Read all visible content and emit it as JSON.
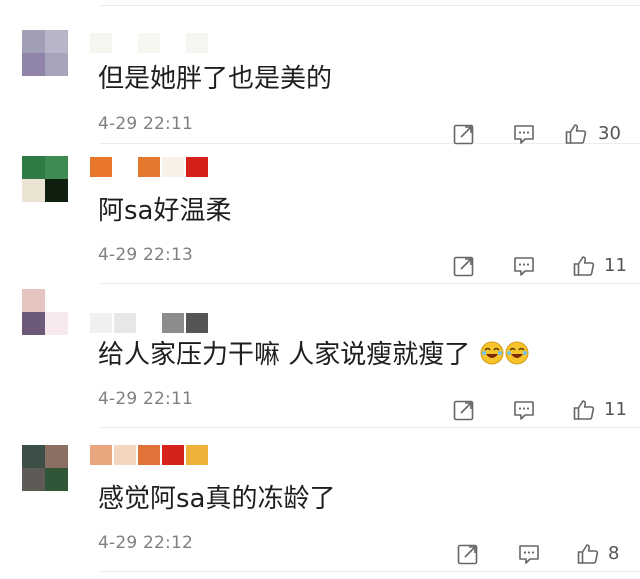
{
  "comments": [
    {
      "avatar_colors": [
        "#a19fb6",
        "#b9b4c8",
        "#9085a8",
        "#a6a3ba"
      ],
      "username_colors": [
        "#f7f5ef",
        "#f8f6f1",
        "#f7f5f2"
      ],
      "text": "但是她胖了也是美的",
      "time": "4-29 22:11",
      "likes": "30"
    },
    {
      "avatar_colors": [
        "#2f7a45",
        "#3f8b53",
        "#ece4d3",
        "#10200f"
      ],
      "username_colors": [
        "#e8772b",
        "#ffffff",
        "#e3782c",
        "#f8f1e7",
        "#d5201a"
      ],
      "text": "阿sa好温柔",
      "time": "4-29 22:13",
      "likes": "11"
    },
    {
      "avatar_colors": [
        "#e6c4c0",
        "#ffffff",
        "#6c5a78",
        "#f7e9ef"
      ],
      "username_colors": [
        "#f1eff0",
        "#e7e6e8",
        "#ffffff",
        "#8c8c8c",
        "#555555"
      ],
      "text": "给人家压力干嘛 人家说瘦就瘦了",
      "emoji_name": "laugh-cry-emoji",
      "time": "4-29 22:11",
      "likes": "11"
    },
    {
      "avatar_colors": [
        "#3b4f47",
        "#8b6f63",
        "#5e5a56",
        "#2f5637"
      ],
      "username_colors": [
        "#e9a57d",
        "#f4d6c0",
        "#e1733a",
        "#d5221b",
        "#efb13a"
      ],
      "text": "感觉阿sa真的冻龄了",
      "time": "4-29 22:12",
      "likes": "8"
    }
  ],
  "icons": {
    "share": "share-icon",
    "comment": "comment-icon",
    "like": "thumbs-up-icon"
  }
}
